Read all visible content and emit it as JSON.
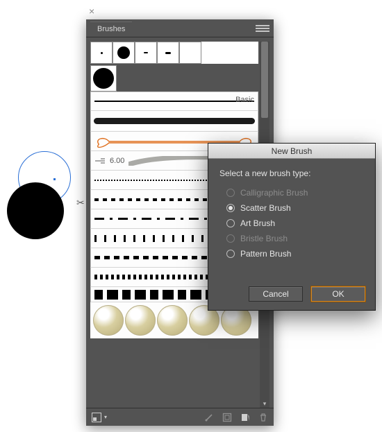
{
  "canvas": {
    "has_blue_circle": true,
    "has_black_circle": true
  },
  "panel": {
    "title": "Brushes",
    "basic_label": "Basic",
    "bristle_value": "6.00",
    "swatches": [
      {
        "size": 3
      },
      {
        "size": 16
      },
      {
        "size": 2
      },
      {
        "size": 3
      },
      {
        "size": 0
      }
    ],
    "footer": {
      "libraries": "Brush Libraries",
      "remove": "Remove Brush Stroke",
      "options": "Options of Selected Object",
      "new": "New Brush",
      "delete": "Delete Brush"
    }
  },
  "dialog": {
    "title": "New Brush",
    "prompt": "Select a new brush type:",
    "options": [
      {
        "label": "Calligraphic Brush",
        "enabled": false,
        "selected": false
      },
      {
        "label": "Scatter Brush",
        "enabled": true,
        "selected": true
      },
      {
        "label": "Art Brush",
        "enabled": true,
        "selected": false
      },
      {
        "label": "Bristle Brush",
        "enabled": false,
        "selected": false
      },
      {
        "label": "Pattern Brush",
        "enabled": true,
        "selected": false
      }
    ],
    "cancel": "Cancel",
    "ok": "OK"
  }
}
